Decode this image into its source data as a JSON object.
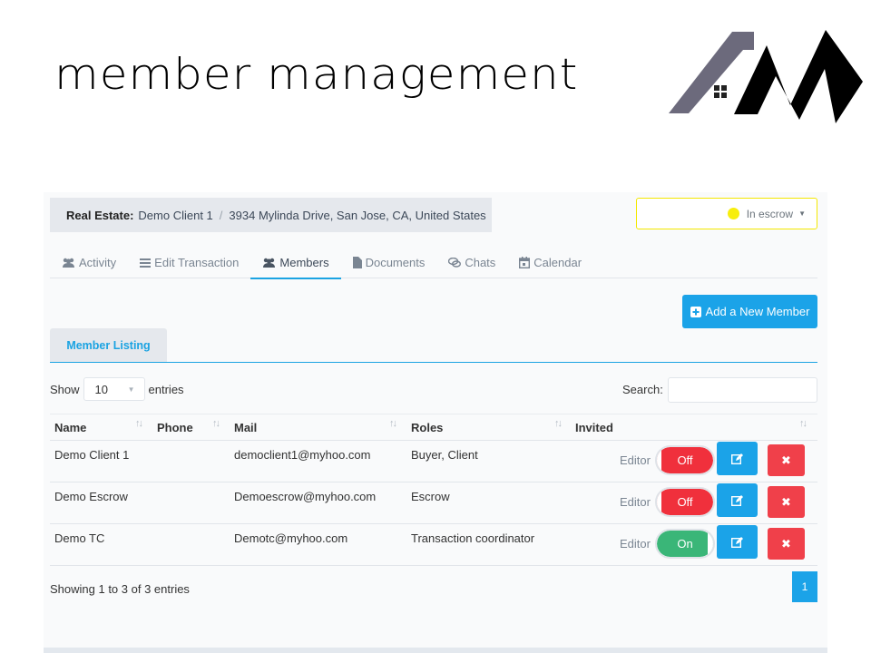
{
  "slide": {
    "title": "member management"
  },
  "breadcrumb": {
    "label": "Real Estate:",
    "client": "Demo Client 1",
    "separator": "/",
    "address": "3934 Mylinda Drive, San Jose, CA, United States"
  },
  "status": {
    "value": "In escrow",
    "dot_color": "#f7ee0d"
  },
  "tabs": [
    {
      "label": "Activity",
      "icon": "users-icon"
    },
    {
      "label": "Edit Transaction",
      "icon": "list-icon"
    },
    {
      "label": "Members",
      "icon": "users-icon",
      "active": true
    },
    {
      "label": "Documents",
      "icon": "file-icon"
    },
    {
      "label": "Chats",
      "icon": "chat-icon"
    },
    {
      "label": "Calendar",
      "icon": "calendar-icon"
    }
  ],
  "add_button": {
    "label": "Add a New Member",
    "icon": "plus-square-icon"
  },
  "subtab": {
    "label": "Member Listing"
  },
  "length": {
    "show": "Show",
    "value": "10",
    "entries": "entries"
  },
  "search": {
    "label": "Search:",
    "value": ""
  },
  "table": {
    "columns": [
      "Name",
      "Phone",
      "Mail",
      "Roles",
      "Invited"
    ],
    "rows": [
      {
        "name": "Demo Client 1",
        "phone": "",
        "mail": "democlient1@myhoo.com",
        "roles": "Buyer, Client",
        "editor": "Editor",
        "toggle": "Off"
      },
      {
        "name": "Demo Escrow",
        "phone": "",
        "mail": "Demoescrow@myhoo.com",
        "roles": "Escrow",
        "editor": "Editor",
        "toggle": "Off"
      },
      {
        "name": "Demo TC",
        "phone": "",
        "mail": "Demotc@myhoo.com",
        "roles": "Transaction coordinator",
        "editor": "Editor",
        "toggle": "On"
      }
    ],
    "delete_glyph": "✖"
  },
  "footer": {
    "info": "Showing 1 to 3 of 3 entries",
    "page": "1"
  },
  "colors": {
    "accent": "#1ba3e8",
    "danger": "#f0404a",
    "success": "#3ab678",
    "off": "#f0303c"
  }
}
